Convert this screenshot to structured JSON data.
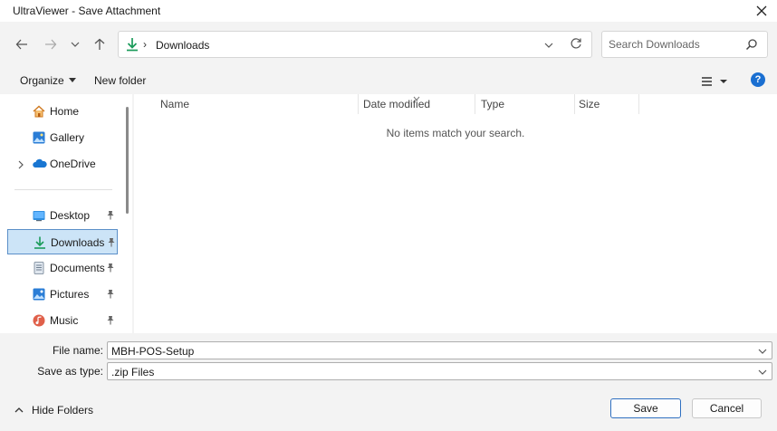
{
  "window": {
    "title": "UltraViewer - Save Attachment",
    "close_icon": "close-icon"
  },
  "navigation": {
    "back_icon": "arrow-left-icon",
    "forward_icon": "arrow-right-icon",
    "recent_icon": "chevron-down-icon",
    "up_icon": "arrow-up-icon"
  },
  "address_bar": {
    "location_icon": "downloads-icon",
    "separator": "›",
    "breadcrumb": "Downloads",
    "dropdown_icon": "chevron-down-icon",
    "refresh_icon": "refresh-icon"
  },
  "search": {
    "placeholder": "Search Downloads",
    "icon": "search-icon"
  },
  "toolbar": {
    "organize_label": "Organize",
    "new_folder_label": "New folder",
    "view_icon": "list-view-icon",
    "help_label": "?"
  },
  "sidebar": {
    "items": [
      {
        "label": "Home",
        "icon": "home-icon"
      },
      {
        "label": "Gallery",
        "icon": "gallery-icon"
      },
      {
        "label": "OneDrive",
        "icon": "cloud-icon"
      },
      {
        "label": "Desktop",
        "icon": "desktop-icon",
        "pinned": true
      },
      {
        "label": "Downloads",
        "icon": "downloads-icon",
        "pinned": true,
        "selected": true
      },
      {
        "label": "Documents",
        "icon": "documents-icon",
        "pinned": true
      },
      {
        "label": "Pictures",
        "icon": "pictures-icon",
        "pinned": true
      },
      {
        "label": "Music",
        "icon": "music-icon",
        "pinned": true
      }
    ]
  },
  "file_list": {
    "columns": [
      "Name",
      "Date modified",
      "Type",
      "Size"
    ],
    "empty_message": "No items match your search."
  },
  "form": {
    "file_name_label": "File name:",
    "file_name_value": "MBH-POS-Setup",
    "save_type_label": "Save as type:",
    "save_type_value": ".zip Files"
  },
  "footer": {
    "hide_folders_label": "Hide Folders",
    "save_label": "Save",
    "cancel_label": "Cancel"
  },
  "colors": {
    "accent": "#1a6fd1",
    "selected_bg": "#cce4f7",
    "selected_border": "#5b8fc8"
  }
}
